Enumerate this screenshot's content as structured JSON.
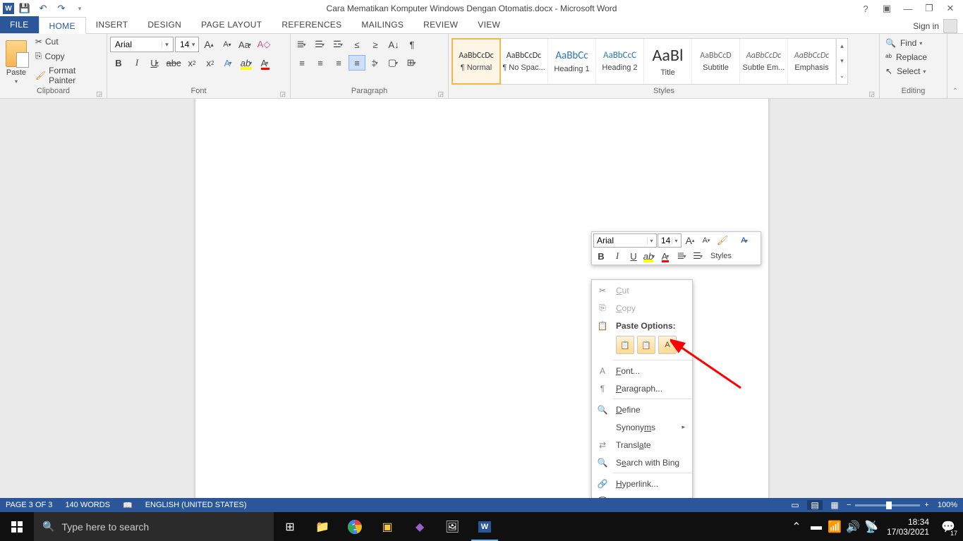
{
  "titlebar": {
    "doc_title": "Cara Mematikan Komputer Windows Dengan Otomatis.docx - Microsoft Word",
    "signin": "Sign in"
  },
  "tabs": {
    "file": "FILE",
    "home": "HOME",
    "insert": "INSERT",
    "design": "DESIGN",
    "layout": "PAGE LAYOUT",
    "references": "REFERENCES",
    "mailings": "MAILINGS",
    "review": "REVIEW",
    "view": "VIEW"
  },
  "clipboard": {
    "paste": "Paste",
    "cut": "Cut",
    "copy": "Copy",
    "format_painter": "Format Painter",
    "label": "Clipboard"
  },
  "font": {
    "name": "Arial",
    "size": "14",
    "label": "Font"
  },
  "paragraph": {
    "label": "Paragraph"
  },
  "styles": {
    "label": "Styles",
    "items": [
      {
        "preview": "AaBbCcDc",
        "name": "¶ Normal",
        "size": "12px",
        "color": "#333"
      },
      {
        "preview": "AaBbCcDc",
        "name": "¶ No Spac...",
        "size": "12px",
        "color": "#333"
      },
      {
        "preview": "AaBbCc",
        "name": "Heading 1",
        "size": "15px",
        "color": "#2e74b5"
      },
      {
        "preview": "AaBbCcC",
        "name": "Heading 2",
        "size": "13px",
        "color": "#2e74b5"
      },
      {
        "preview": "AaBl",
        "name": "Title",
        "size": "24px",
        "color": "#333"
      },
      {
        "preview": "AaBbCcD",
        "name": "Subtitle",
        "size": "12px",
        "color": "#666"
      },
      {
        "preview": "AaBbCcDc",
        "name": "Subtle Em...",
        "size": "12px",
        "color": "#666",
        "italic": true
      },
      {
        "preview": "AaBbCcDc",
        "name": "Emphasis",
        "size": "12px",
        "color": "#666",
        "italic": true
      }
    ]
  },
  "editing": {
    "find": "Find",
    "replace": "Replace",
    "select": "Select",
    "label": "Editing"
  },
  "mini": {
    "font": "Arial",
    "size": "14",
    "styles": "Styles"
  },
  "ctx": {
    "cut": "Cut",
    "copy": "Copy",
    "paste_options": "Paste Options:",
    "font": "Font...",
    "paragraph": "Paragraph...",
    "define": "Define",
    "synonyms": "Synonyms",
    "translate": "Translate",
    "search_bing": "Search with Bing",
    "hyperlink": "Hyperlink...",
    "new_comment": "New Comment"
  },
  "status": {
    "page": "PAGE 3 OF 3",
    "words": "140 WORDS",
    "lang": "ENGLISH (UNITED STATES)",
    "zoom": "100%"
  },
  "taskbar": {
    "search_placeholder": "Type here to search",
    "time": "18:34",
    "date": "17/03/2021",
    "notif": "17"
  }
}
